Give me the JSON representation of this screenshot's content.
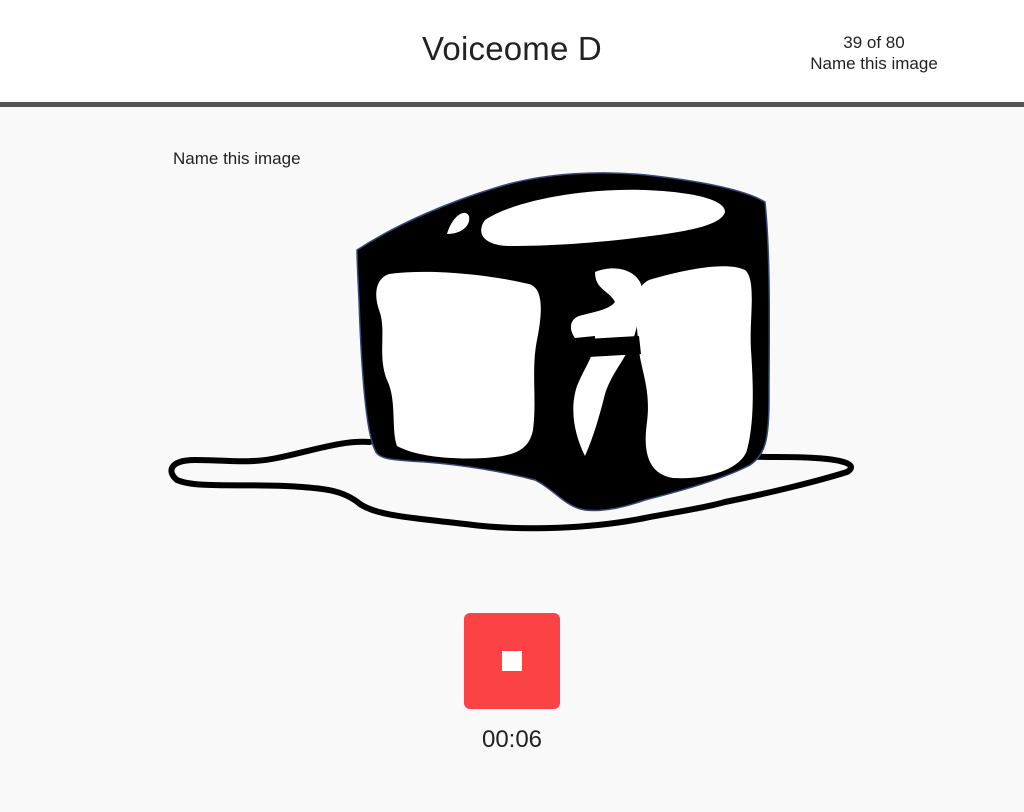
{
  "header": {
    "title": "Voiceome D",
    "progress": {
      "counter": "39 of 80",
      "task_label": "Name this image"
    }
  },
  "task": {
    "prompt": "Name this image",
    "image_icon": "ice-cube-melting-icon"
  },
  "recorder": {
    "state": "recording",
    "stop_icon": "stop-icon",
    "button_color": "#fb4245",
    "timer": "00:06"
  }
}
